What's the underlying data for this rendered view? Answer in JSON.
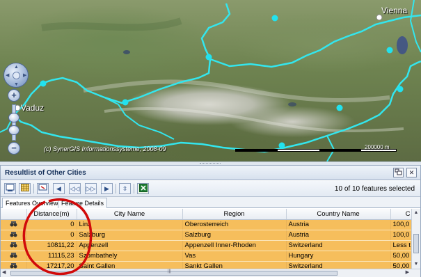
{
  "map": {
    "labels": {
      "vaduz": "Vaduz",
      "vienna": "Vienna"
    },
    "copyright": "(c) SynerGIS Informationssysteme, 2008-09",
    "scale_label": "200000 m",
    "colors": {
      "border": "#33e6ee",
      "city_point": "#22e2ee"
    }
  },
  "nav_control": {
    "zoom_in_icon": "plus-icon",
    "zoom_out_icon": "minus-icon"
  },
  "panel": {
    "title": "Resultlist of Other Cities",
    "header_buttons": {
      "dock_icon": "dock-icon",
      "close_label": "✕"
    },
    "toolbar": {
      "buttons": [
        "zoom-to-icon",
        "table-icon",
        "select-icon",
        "first-icon",
        "previous-icon",
        "next-icon",
        "last-icon",
        "expand-icon",
        "excel-export-icon"
      ],
      "status": "10 of 10 features selected"
    },
    "tabs": [
      {
        "label": "Features Overview"
      },
      {
        "label": "Feature Details"
      }
    ],
    "table": {
      "columns": [
        "",
        "Distance(m)",
        "City Name",
        "Region",
        "Country Name",
        "C"
      ],
      "rows": [
        {
          "distance": "0",
          "city": "Linz",
          "region": "Oberosterreich",
          "country": "Austria",
          "extra": "100,0"
        },
        {
          "distance": "0",
          "city": "Salzburg",
          "region": "Salzburg",
          "country": "Austria",
          "extra": "100,0"
        },
        {
          "distance": "10811,22",
          "city": "Appenzell",
          "region": "Appenzell Inner-Rhoden",
          "country": "Switzerland",
          "extra": "Less t"
        },
        {
          "distance": "11115,23",
          "city": "Szombathely",
          "region": "Vas",
          "country": "Hungary",
          "extra": "50,00"
        },
        {
          "distance": "17217,20",
          "city": "Saint Gallen",
          "region": "Sankt Gallen",
          "country": "Switzerland",
          "extra": "50,00"
        }
      ],
      "row_color": "#f6be5c"
    }
  },
  "annotation": {
    "color": "#d10a0a",
    "shape": "ellipse"
  }
}
